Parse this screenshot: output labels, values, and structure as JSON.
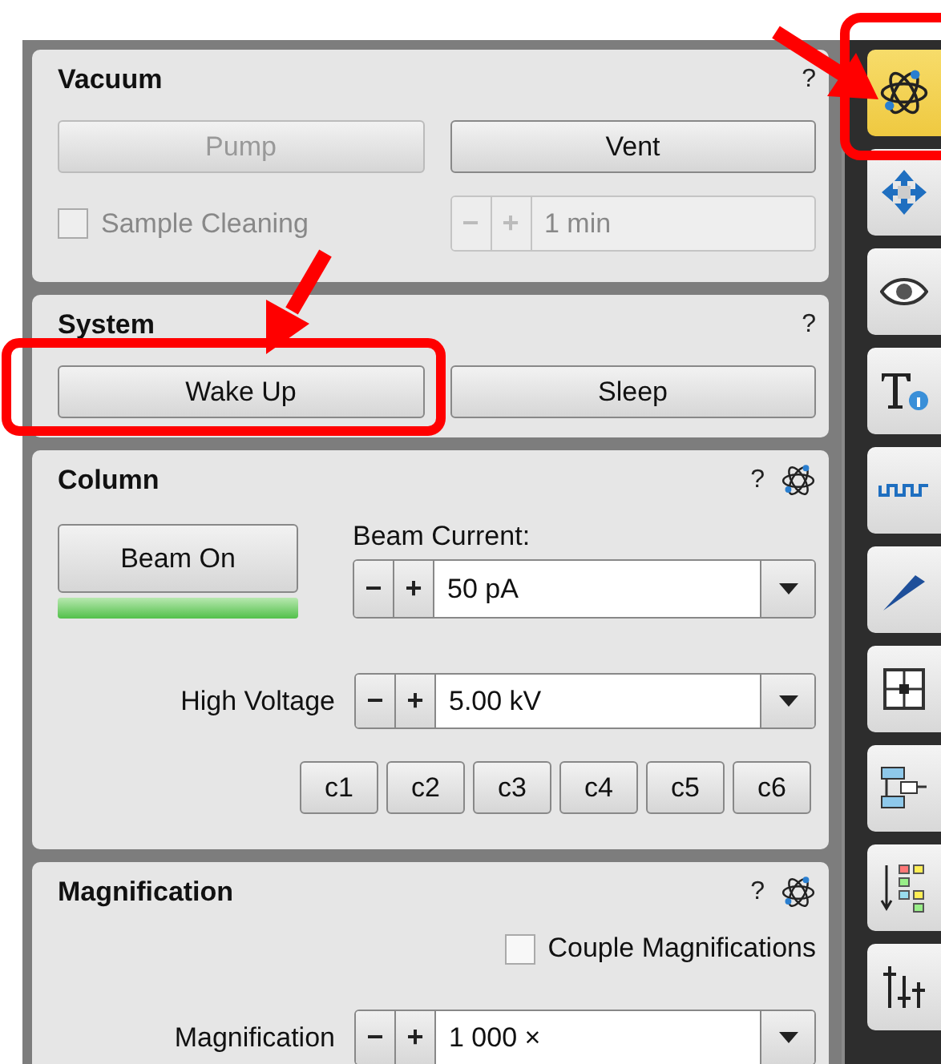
{
  "panels": [
    {
      "kind": "vacuum",
      "title": "Vacuum",
      "help": "?",
      "buttons": [
        {
          "label": "Pump",
          "disabled": true
        },
        {
          "label": "Vent",
          "disabled": false
        }
      ],
      "checkbox": {
        "label": "Sample Cleaning",
        "checked": false,
        "disabled": true
      },
      "spinner": {
        "minus": "−",
        "plus": "+",
        "value": "1 min",
        "disabled": true
      }
    },
    {
      "kind": "system",
      "title": "System",
      "help": "?",
      "buttons": [
        {
          "label": "Wake Up",
          "disabled": false
        },
        {
          "label": "Sleep",
          "disabled": false
        }
      ]
    },
    {
      "kind": "column",
      "title": "Column",
      "help": "?",
      "beam_button": {
        "label": "Beam On",
        "on": true
      },
      "beam_current": {
        "label": "Beam Current:",
        "minus": "−",
        "plus": "+",
        "value": "50 pA"
      },
      "high_voltage": {
        "label": "High Voltage",
        "minus": "−",
        "plus": "+",
        "value": "5.00 kV"
      },
      "presets": [
        "c1",
        "c2",
        "c3",
        "c4",
        "c5",
        "c6"
      ]
    },
    {
      "kind": "magnification",
      "title": "Magnification",
      "help": "?",
      "checkbox": {
        "label": "Couple Magnifications",
        "checked": false,
        "disabled": false
      },
      "magnification": {
        "label": "Magnification",
        "minus": "−",
        "plus": "+",
        "value": "1 000 ×"
      }
    }
  ],
  "sidebar": {
    "tabs": [
      {
        "selected": true
      },
      {
        "selected": false
      },
      {
        "selected": false
      },
      {
        "selected": false
      },
      {
        "selected": false
      },
      {
        "selected": false
      },
      {
        "selected": false
      },
      {
        "selected": false
      },
      {
        "selected": false
      },
      {
        "selected": false
      }
    ]
  }
}
